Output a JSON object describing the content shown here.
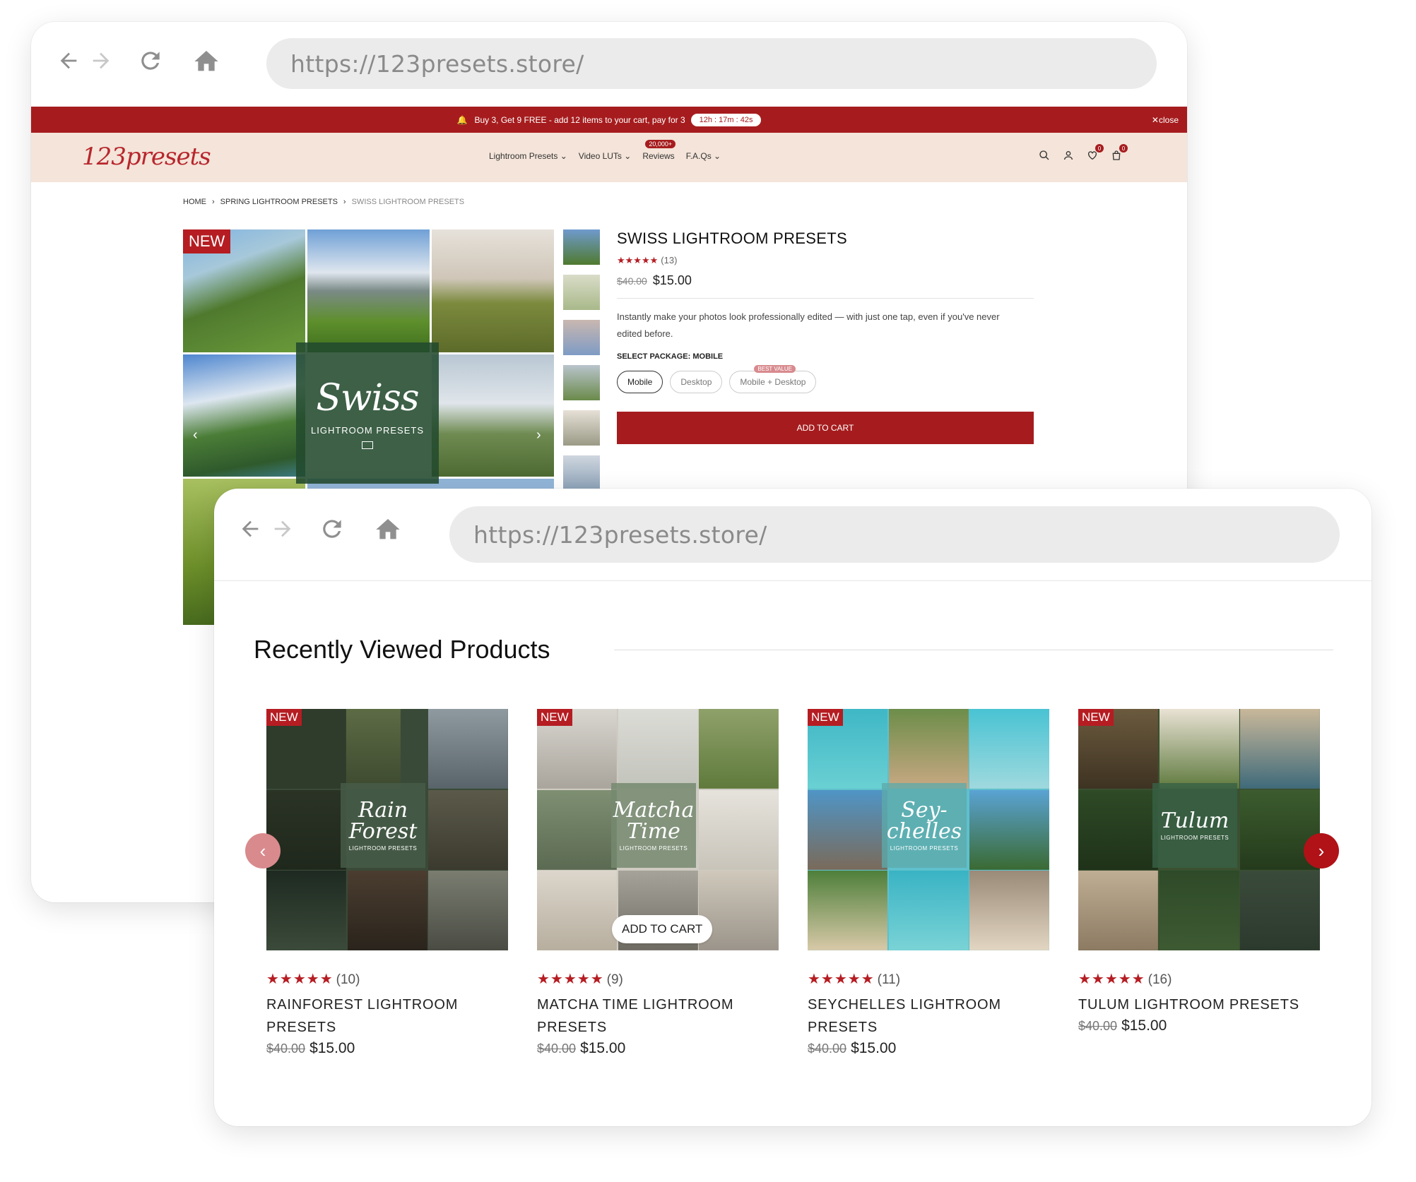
{
  "colors": {
    "brand_red": "#a61c1e",
    "header_bg": "#f4e4d9",
    "url_bg": "#ebebeb"
  },
  "browser_back": {
    "url": "https://123presets.store/",
    "icons": [
      "arrow-left-icon",
      "arrow-right-icon",
      "reload-icon",
      "home-icon"
    ]
  },
  "site": {
    "promo": {
      "text": "Buy 3, Get 9 FREE - add 12 items to your cart, pay for 3",
      "timer": "12h : 17m : 42s",
      "close": "close"
    },
    "logo": "123presets",
    "nav": [
      {
        "label": "Lightroom Presets",
        "has_dropdown": true
      },
      {
        "label": "Video LUTs",
        "has_dropdown": true
      },
      {
        "label": "Reviews",
        "badge": "20,000+"
      },
      {
        "label": "F.A.Qs",
        "has_dropdown": true
      }
    ],
    "header_icons": {
      "wishlist_count": "0",
      "cart_count": "0"
    },
    "breadcrumb": [
      "HOME",
      "SPRING LIGHTROOM PRESETS",
      "SWISS LIGHTROOM PRESETS"
    ],
    "gallery": {
      "badge": "NEW",
      "overlay_title": "Swiss",
      "overlay_sub": "LIGHTROOM PRESETS"
    },
    "product": {
      "title": "SWISS LIGHTROOM PRESETS",
      "stars": "★★★★★",
      "review_count": "(13)",
      "old_price": "$40.00",
      "price": "$15.00",
      "description": "Instantly make your photos look professionally edited — with just one tap, even if you've never edited before.",
      "package_label": "SELECT PACKAGE: MOBILE",
      "packages": [
        "Mobile",
        "Desktop",
        "Mobile + Desktop"
      ],
      "best_value": "BEST VALUE",
      "add_to_cart": "ADD TO CART"
    }
  },
  "browser_front": {
    "url": "https://123presets.store/",
    "section_title": "Recently Viewed Products",
    "products": [
      {
        "badge": "NEW",
        "overlay": "Rain Forest",
        "overlay_sub": "LIGHTROOM PRESETS",
        "stars": "★★★★★",
        "count": "(10)",
        "name": "RAINFOREST LIGHTROOM PRESETS",
        "old_price": "$40.00",
        "price": "$15.00"
      },
      {
        "badge": "NEW",
        "overlay": "Matcha Time",
        "overlay_sub": "LIGHTROOM PRESETS",
        "stars": "★★★★★",
        "count": "(9)",
        "name": "MATCHA TIME LIGHTROOM PRESETS",
        "old_price": "$40.00",
        "price": "$15.00",
        "quick_add": "ADD TO CART"
      },
      {
        "badge": "NEW",
        "overlay": "Sey-chelles",
        "overlay_sub": "LIGHTROOM PRESETS",
        "stars": "★★★★★",
        "count": "(11)",
        "name": "SEYCHELLES LIGHTROOM PRESETS",
        "old_price": "$40.00",
        "price": "$15.00"
      },
      {
        "badge": "NEW",
        "overlay": "Tulum",
        "overlay_sub": "LIGHTROOM PRESETS",
        "stars": "★★★★★",
        "count": "(16)",
        "name": "TULUM LIGHTROOM PRESETS",
        "old_price": "$40.00",
        "price": "$15.00"
      }
    ]
  }
}
